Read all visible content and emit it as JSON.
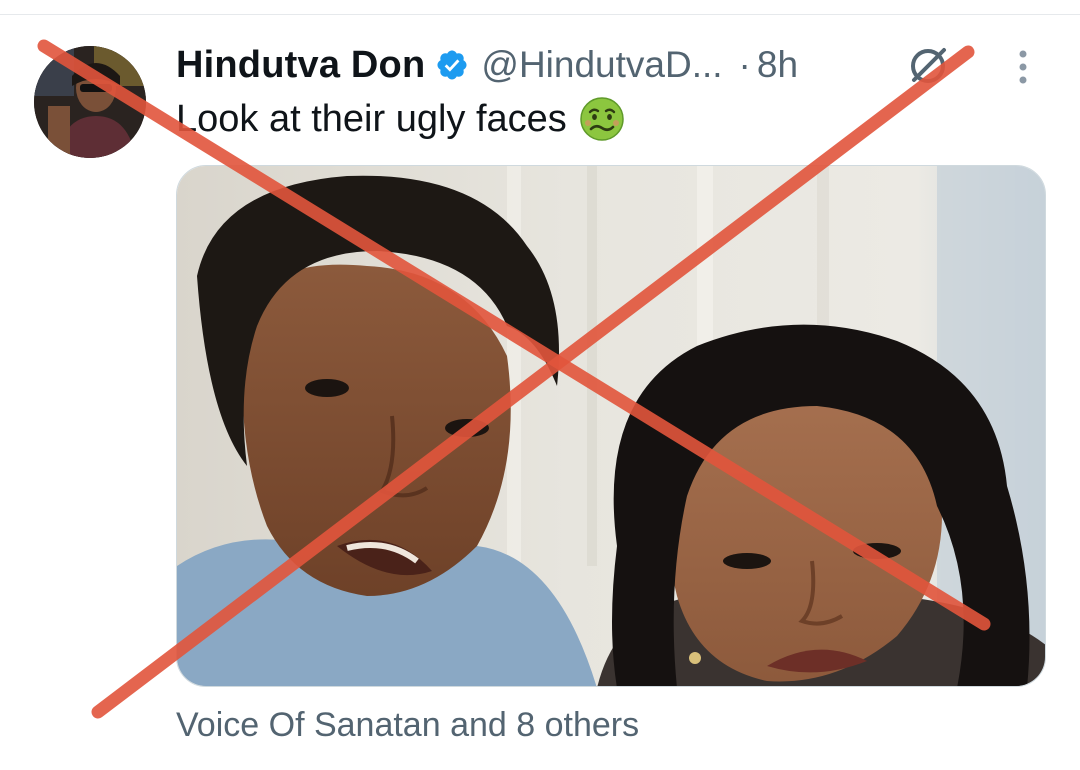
{
  "tweet": {
    "display_name": "Hindutva Don",
    "verified": true,
    "handle": "@HindutvaD...",
    "separator": "·",
    "timestamp": "8h",
    "text": "Look at their ugly faces",
    "emoji_icon": "nauseated-face-icon",
    "media_icon": "photo-of-two-people",
    "social_context": "Voice Of Sanatan and 8 others"
  },
  "icons": {
    "verified": "verified-badge-icon",
    "grok": "grok-icon",
    "more": "more-vertical-icon"
  },
  "colors": {
    "verified_blue": "#1d9bf0",
    "text_primary": "#0f1419",
    "text_secondary": "#536471",
    "cross_annotation": "#e2553c"
  }
}
